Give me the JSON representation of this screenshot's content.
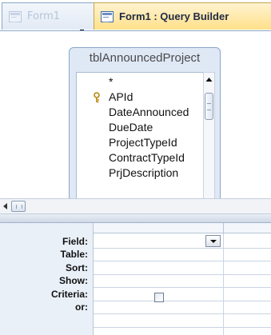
{
  "tabs": [
    {
      "label": "Form1",
      "active": false
    },
    {
      "label": "Form1 : Query Builder",
      "active": true
    }
  ],
  "table_box": {
    "title": "tblAnnouncedProject",
    "fields": [
      {
        "label": "*",
        "primary_key": false
      },
      {
        "label": "APId",
        "primary_key": true,
        "icon": "key-icon"
      },
      {
        "label": "DateAnnounced",
        "primary_key": false
      },
      {
        "label": "DueDate",
        "primary_key": false
      },
      {
        "label": "ProjectTypeId",
        "primary_key": false
      },
      {
        "label": "ContractTypeId",
        "primary_key": false
      },
      {
        "label": "PrjDescription",
        "primary_key": false
      }
    ]
  },
  "grid": {
    "row_labels": [
      "Field:",
      "Table:",
      "Sort:",
      "Show:",
      "Criteria:",
      "or:"
    ],
    "show_checked": false
  },
  "colors": {
    "accent": "#ffe08a",
    "pane_bg": "#dfe8f5",
    "border": "#8ba6c9"
  }
}
